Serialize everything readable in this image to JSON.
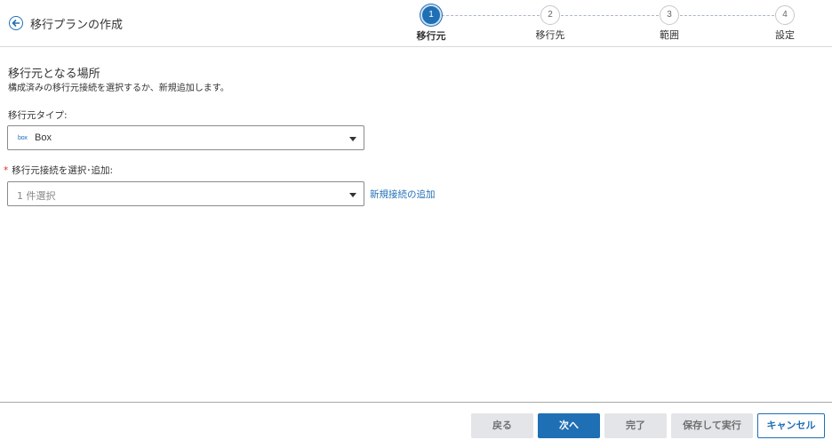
{
  "header": {
    "title": "移行プランの作成",
    "back_icon": "back-arrow-icon"
  },
  "stepper": {
    "steps": [
      {
        "number": "1",
        "label": "移行元",
        "active": true
      },
      {
        "number": "2",
        "label": "移行先",
        "active": false
      },
      {
        "number": "3",
        "label": "範囲",
        "active": false
      },
      {
        "number": "4",
        "label": "設定",
        "active": false
      }
    ]
  },
  "main": {
    "section_title": "移行元となる場所",
    "section_description": "構成済みの移行元接続を選択するか、新規追加します。",
    "source_type": {
      "label": "移行元タイプ:",
      "logo_text": "box",
      "value": "Box"
    },
    "connection": {
      "required_mark": "*",
      "label": "移行元接続を選択･追加:",
      "placeholder": "1 件選択",
      "add_link": "新規接続の追加"
    }
  },
  "footer": {
    "back_label": "戻る",
    "next_label": "次へ",
    "finish_label": "完了",
    "save_run_label": "保存して実行",
    "cancel_label": "キャンセル"
  },
  "colors": {
    "accent": "#1f6fb5",
    "disabled_bg": "#e3e5e8",
    "required": "#d93025"
  }
}
